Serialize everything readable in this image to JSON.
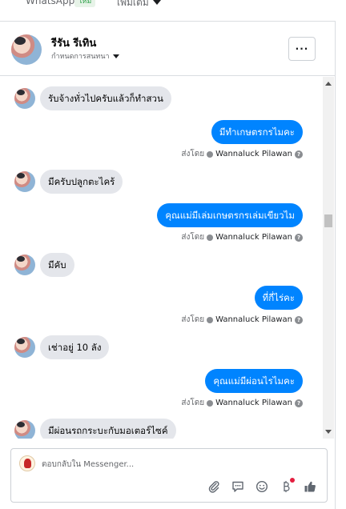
{
  "topbar": {
    "tab_whatsapp": "WhatsApp",
    "badge_new": "ใหม่",
    "tab_more": "เพิ่มเติม"
  },
  "header": {
    "contact_name": "รีรัน รีเทิน",
    "action_label": "กำหนดการสนทนา",
    "more_label": "···"
  },
  "messages": [
    {
      "dir": "in",
      "text": "รับจ้างทั่วไปครับแล้วก็ทำสวน"
    },
    {
      "dir": "out",
      "text": "มีทำเกษตรกรไมคะ",
      "sent_prefix": "ส่งโดย",
      "sender": "Wannaluck Pilawan"
    },
    {
      "dir": "in",
      "text": "มีครับปลูกตะไคร้"
    },
    {
      "dir": "out",
      "text": "คุณแม่มีเล่มเกษตรกรเล่มเขียวไม",
      "sent_prefix": "ส่งโดย",
      "sender": "Wannaluck Pilawan"
    },
    {
      "dir": "in",
      "text": "มีคับ"
    },
    {
      "dir": "out",
      "text": "ที่กี่ไร่คะ",
      "sent_prefix": "ส่งโดย",
      "sender": "Wannaluck Pilawan"
    },
    {
      "dir": "in",
      "text": "เช่าอยู่ 10 ลัง"
    },
    {
      "dir": "out",
      "text": "คุณแม่มีผ่อนไรไมคะ",
      "sent_prefix": "ส่งโดย",
      "sender": "Wannaluck Pilawan"
    },
    {
      "dir": "in",
      "text": "มีผ่อนรถกระบะกับมอเตอร์ไซค์"
    }
  ],
  "composer": {
    "placeholder": "ตอบกลับใน Messenger...",
    "icons": [
      "attachment-icon",
      "saved-reply-icon",
      "emoji-icon",
      "payment-icon",
      "like-icon"
    ]
  },
  "colors": {
    "outgoing_bubble": "#0084ff",
    "incoming_bubble": "#e4e6eb",
    "notification_dot": "#e41e3f"
  }
}
